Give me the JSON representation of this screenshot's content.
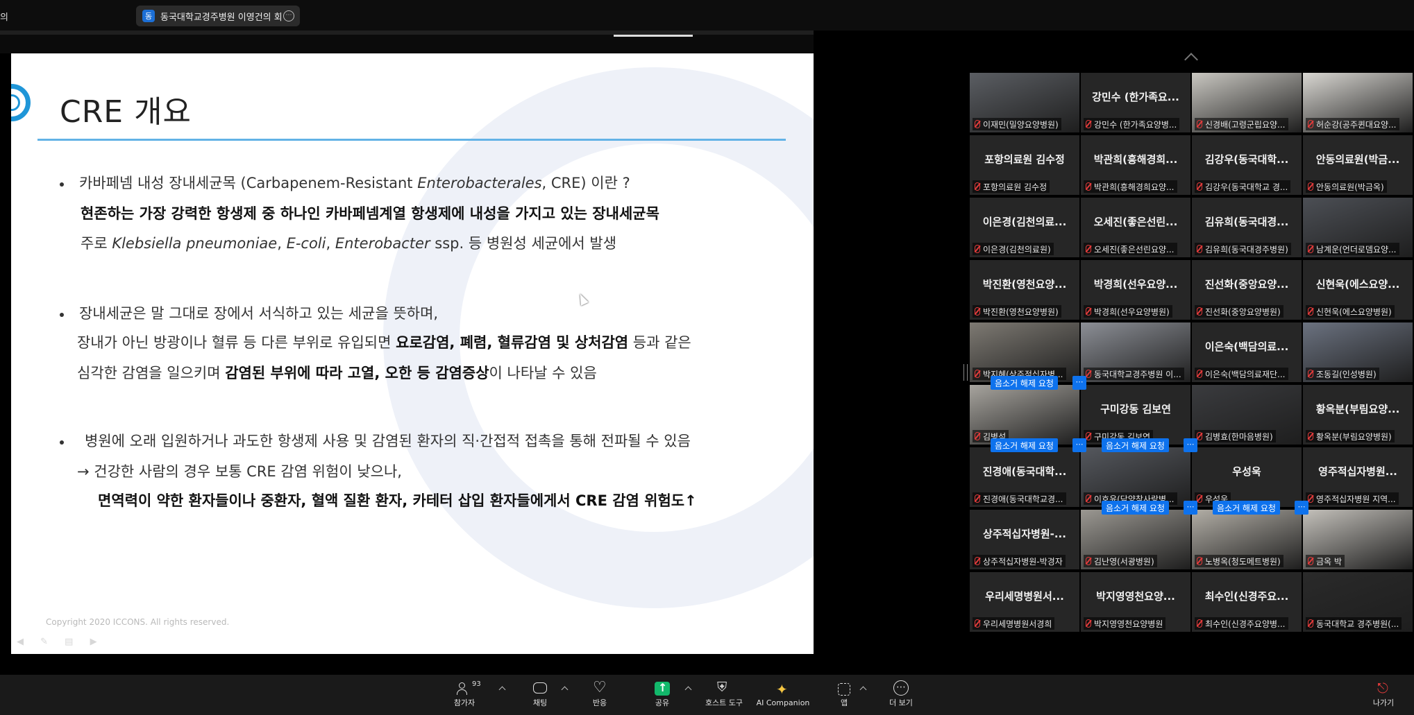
{
  "top_bar": {
    "left_text": "의",
    "meeting_chip": {
      "badge": "동",
      "title": "동국대학교경주병원 이영건의 회"
    }
  },
  "slide": {
    "title": "CRE 개요",
    "b1": {
      "l1_a": "카바페넴 내성 장내세균목 (Carbapenem-Resistant ",
      "l1_i": "Enterobacterales",
      "l1_b": ", CRE) 이란 ?",
      "l2": "현존하는 가장 강력한 항생제 중 하나인 카바페넴계열 항생제에 내성을 가지고 있는 장내세균목",
      "l3_a": "주로  ",
      "l3_i1": "Klebsiella pneumoniae",
      "l3_s1": ",  ",
      "l3_i2": "E-coli",
      "l3_s2": ",  ",
      "l3_i3": "Enterobacter",
      "l3_b": " ssp. 등 병원성 세균에서 발생"
    },
    "b2": {
      "l1": "장내세균은 말 그대로 장에서 서식하고 있는 세균을 뜻하며,",
      "l2_a": "장내가 아닌 방광이나 혈류 등 다른 부위로 유입되면 ",
      "l2_b": "요로감염, 폐렴, 혈류감염 및 상처감염",
      "l2_c": " 등과 같은",
      "l3_a": "심각한 감염을 일으키며  ",
      "l3_b": "감염된 부위에 따라 고열, 오한 등 감염증상",
      "l3_c": "이  나타날 수 있음"
    },
    "b3": {
      "l1": "병원에 오래 입원하거나 과도한 항생제 사용 및 감염된 환자의 직·간접적 접촉을 통해 전파될 수 있음",
      "l2": "→ 건강한 사람의 경우 보통 CRE 감염 위험이 낮으나,",
      "l3": "면역력이 약한 환자들이나 중환자, 혈액 질환 환자, 카테터 삽입 환자들에게서 CRE 감염 위험도↑"
    },
    "copyright": "Copyright 2020 ICCONS. All rights reserved.",
    "tools": "◀ ✎ ▤ ▶"
  },
  "gallery": {
    "unmute_request": "음소거 해제 요청",
    "more": "⋯",
    "tiles": [
      {
        "title": "",
        "label": "이재민(밀양요양병원)",
        "video": "#5b5e63"
      },
      {
        "title": "강민수 (한가족요...",
        "label": "강민수 (한가족요양병..."
      },
      {
        "title": "",
        "label": "신경배(고령군립요양...",
        "video": "#c9c7c1"
      },
      {
        "title": "",
        "label": "허순강(공주퀸대요양...",
        "video": "#d9d7d2"
      },
      {
        "title": "포항의료원 김수정",
        "label": "포항의료원 김수정"
      },
      {
        "title": "박관희(흥해경희...",
        "label": "박관희(흥해경희요양..."
      },
      {
        "title": "김강우(동국대학...",
        "label": "김강우(동국대학교 경..."
      },
      {
        "title": "안동의료원(박금...",
        "label": "안동의료원(박금옥)"
      },
      {
        "title": "이은경(김천의료...",
        "label": "이은경(김천의료원)"
      },
      {
        "title": "오세진(좋은선린...",
        "label": "오세진(좋은선린요양..."
      },
      {
        "title": "김유희(동국대경...",
        "label": "김유희(동국대경주병원)"
      },
      {
        "title": "",
        "label": "남계운(언더로뎀요양...",
        "video": "#4c4f55"
      },
      {
        "title": "박진환(영천요양...",
        "label": "박진환(영천요양병원)"
      },
      {
        "title": "박경희(선우요양...",
        "label": "박경희(선우요양병원)"
      },
      {
        "title": "진선화(중앙요양...",
        "label": "진선화(중앙요양병원)"
      },
      {
        "title": "신현욱(에스요양...",
        "label": "신현욱(에스요양병원)"
      },
      {
        "title": "",
        "label": "박지혜(상주적십자병...",
        "video": "#7e7a73"
      },
      {
        "title": "",
        "label": "동국대학교경주병원 이...",
        "video": "#8c8f96"
      },
      {
        "title": "이은숙(백담의료...",
        "label": "이은숙(백담의료재단..."
      },
      {
        "title": "",
        "label": "조동길(인성병원)",
        "video": "#6b7280"
      },
      {
        "title": "",
        "label": "김병석",
        "video": "#a7a49e"
      },
      {
        "title": "구미강동 김보연",
        "label": "구미강동 김보연"
      },
      {
        "title": "",
        "label": "김병효(한마음병원)",
        "video": "#3a3b3e"
      },
      {
        "title": "황옥분(부림요양...",
        "label": "황옥분(부림요양병원)"
      },
      {
        "title": "진경애(동국대학...",
        "label": "진경애(동국대학교경..."
      },
      {
        "title": "",
        "label": "이호윤(담양참사랑병...",
        "video": "#55585e"
      },
      {
        "title": "우성욱",
        "label": "우성욱"
      },
      {
        "title": "영주적십자병원...",
        "label": "영주적십자병원 지역..."
      },
      {
        "title": "상주적십자병원-...",
        "label": "상주적십자병원-박경자"
      },
      {
        "title": "",
        "label": "김난영(서광병원)",
        "video": "#9b9892"
      },
      {
        "title": "",
        "label": "노병옥(청도메트병원)",
        "video": "#b2aea6"
      },
      {
        "title": "",
        "label": "금옥 박",
        "video": "#c4c1bb"
      },
      {
        "title": "우리세명병원서...",
        "label": "우리세명병원서경희"
      },
      {
        "title": "박지영영천요양...",
        "label": "박지영영천요양병원"
      },
      {
        "title": "최수인(신경주요...",
        "label": "최수인(신경주요양병..."
      },
      {
        "title": "",
        "label": "동국대학교 경주병원(...",
        "video": "#2a2a2a"
      }
    ]
  },
  "toolbar": {
    "participants": {
      "label": "참가자",
      "count": "93"
    },
    "chat": "채팅",
    "reactions": "반응",
    "share": "공유",
    "host_tools": "호스트 도구",
    "ai_companion": "AI Companion",
    "apps": "앱",
    "more": "더 보기",
    "leave": "나가기"
  },
  "colors": {
    "accent": "#0e72ed",
    "speaking": "#22c55e",
    "share_green": "#12b86b",
    "slide_rule": "#63b3e6"
  }
}
